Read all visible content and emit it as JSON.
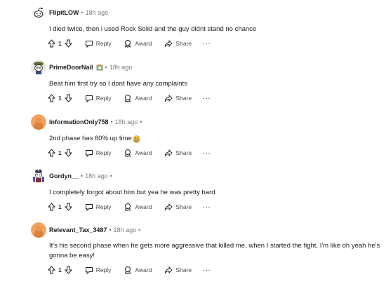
{
  "comments": [
    {
      "author": "FlipitLOW",
      "time": "18h ago",
      "body": "I died twice, then i used Rock Solid and the guy didnt stand no chance",
      "votes": "1",
      "avatar_color": "#ffffff",
      "avatar_icon": "snoo-avatar-icon",
      "has_flair": false
    },
    {
      "author": "PrimeDoorNail",
      "time": "18h ago",
      "body": "Beat him first try so I dont have any complaints",
      "votes": "1",
      "avatar_color": "#e9ebe3",
      "avatar_icon": "custom-avatar-icon",
      "has_flair": true,
      "flair_icon": "flair-icon"
    },
    {
      "author": "InformationOnly758",
      "time": "18h ago",
      "body": "2nd phase has 80% up time",
      "body_emoji": "grimacing-emoji-icon",
      "votes": "1",
      "avatar_color": "#f0a35e",
      "avatar_icon": "snoo-face-icon",
      "has_flair": false
    },
    {
      "author": "Gordyn__",
      "time": "18h ago",
      "body": "I completely forgot about him but yea he was pretty hard",
      "votes": "1",
      "avatar_color": "#ffffff",
      "avatar_icon": "custom-avatar-icon",
      "has_flair": false
    },
    {
      "author": "Relevant_Tax_3487",
      "time": "18h ago",
      "body": "It's his second phase when he gets more aggressive that killed me, when I started the fight, I'm like oh yeah he's gonna be easy!",
      "votes": "1",
      "avatar_color": "#f0a35e",
      "avatar_icon": "snoo-face-icon",
      "has_flair": false
    }
  ],
  "actions": {
    "reply_label": "Reply",
    "award_label": "Award",
    "share_label": "Share",
    "more_label": "···",
    "separator": "•"
  },
  "colors": {
    "text": "#1c1c1c",
    "meta": "#7c7c7c",
    "action": "#4b4b4b",
    "avatar_orange": "#f0a35e"
  }
}
